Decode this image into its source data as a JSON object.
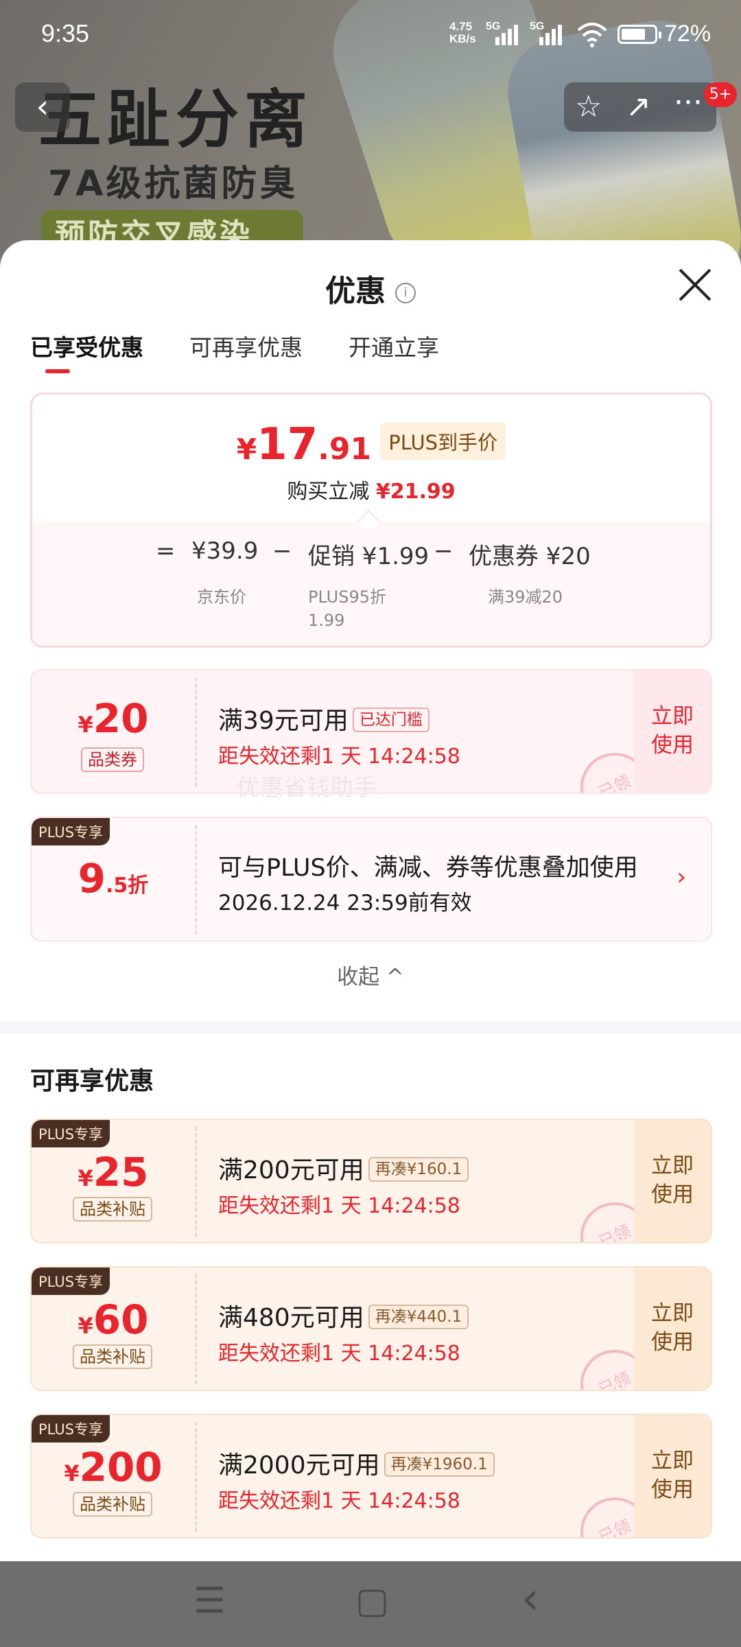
{
  "status_bar": {
    "time": "9:35",
    "net_speed_top": "4.75",
    "net_speed_bottom": "KB/s",
    "sig1": "5G",
    "sig2": "5G",
    "battery": "72%"
  },
  "banner": {
    "line1": "五趾分离",
    "line2": "7A级抗菌防臭",
    "line3": "预防交叉感染",
    "badge": "5+"
  },
  "sheet": {
    "title": "优惠",
    "tabs": [
      "已享受优惠",
      "可再享优惠",
      "开通立享"
    ]
  },
  "summary": {
    "yen": "¥",
    "price_int": "17",
    "price_dec": ".91",
    "plus_label": "PLUS到手价",
    "reduce_label": "购买立减",
    "reduce_amount": "¥21.99",
    "eq": "=",
    "jd_price": "¥39.9",
    "minus": "−",
    "promo": "促销 ¥1.99",
    "coupon": "优惠券 ¥20",
    "jd_label": "京东价",
    "promo_sub1": "PLUS95折",
    "promo_sub2": "1.99",
    "coupon_sub": "满39减20"
  },
  "coupon_main": {
    "yen": "¥",
    "amount": "20",
    "unit": "品类券",
    "condition": "满39元可用",
    "tag": "已达门槛",
    "expire": "距失效还剩1 天 14:24:58",
    "use1": "立即",
    "use2": "使用",
    "stamp": "已领"
  },
  "watermark": "优惠省钱助手",
  "discount": {
    "corner": "PLUS专享",
    "big": "9",
    "small": ".5折",
    "text": "可与PLUS价、满减、券等优惠叠加使用",
    "valid": "2026.12.24 23:59前有效",
    "arrow": "›"
  },
  "collapse": "收起 ^",
  "more_section": {
    "title": "可再享优惠"
  },
  "more_coupons": [
    {
      "corner": "PLUS专享",
      "yen": "¥",
      "amount": "25",
      "unit": "品类补贴",
      "condition": "满200元可用",
      "tag": "再凑¥160.1",
      "expire": "距失效还剩1 天 14:24:58",
      "use1": "立即",
      "use2": "使用",
      "stamp": "已领"
    },
    {
      "corner": "PLUS专享",
      "yen": "¥",
      "amount": "60",
      "unit": "品类补贴",
      "condition": "满480元可用",
      "tag": "再凑¥440.1",
      "expire": "距失效还剩1 天 14:24:58",
      "use1": "立即",
      "use2": "使用",
      "stamp": "已领"
    },
    {
      "corner": "PLUS专享",
      "yen": "¥",
      "amount": "200",
      "unit": "品类补贴",
      "condition": "满2000元可用",
      "tag": "再凑¥1960.1",
      "expire": "距失效还剩1 天 14:24:58",
      "use1": "立即",
      "use2": "使用",
      "stamp": "已领"
    }
  ],
  "nav_bar": {
    "menu": "☰",
    "home": "▢",
    "back": "‹"
  }
}
